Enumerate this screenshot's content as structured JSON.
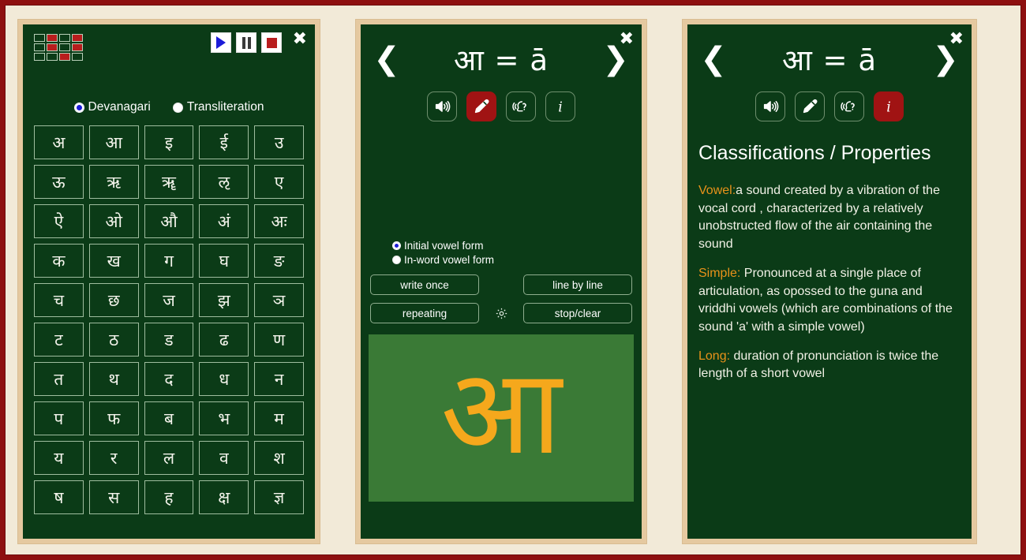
{
  "theme": {
    "outer_border": "#8e1010",
    "page_bg": "#f2ead8",
    "panel_frame": "#e5c9a0",
    "board_bg": "#0b3b17",
    "accent_red": "#a01313",
    "accent_orange": "#e8921a",
    "canvas_bg": "#3a7a36",
    "ink": "#f5a81c",
    "radio_selected": "#1b1bd8"
  },
  "panel1": {
    "close_label": "✖",
    "grid_icon_name": "grid-icon",
    "grid_icon_pattern": [
      [
        0,
        1,
        0,
        1
      ],
      [
        0,
        1,
        0,
        1
      ],
      [
        0,
        0,
        1,
        0
      ]
    ],
    "media": [
      {
        "name": "play-button",
        "label": "play"
      },
      {
        "name": "pause-button",
        "label": "pause"
      },
      {
        "name": "stop-button",
        "label": "stop"
      }
    ],
    "script_modes": [
      {
        "label": "Devanagari",
        "selected": true
      },
      {
        "label": "Transliteration",
        "selected": false
      }
    ],
    "letters": [
      "अ",
      "आ",
      "इ",
      "ई",
      "उ",
      "ऊ",
      "ऋ",
      "ॠ",
      "ऌ",
      "ए",
      "ऐ",
      "ओ",
      "औ",
      "अं",
      "अः",
      "क",
      "ख",
      "ग",
      "घ",
      "ङ",
      "च",
      "छ",
      "ज",
      "झ",
      "ञ",
      "ट",
      "ठ",
      "ड",
      "ढ",
      "ण",
      "त",
      "थ",
      "द",
      "ध",
      "न",
      "प",
      "फ",
      "ब",
      "भ",
      "म",
      "य",
      "र",
      "ल",
      "व",
      "श",
      "ष",
      "स",
      "ह",
      "क्ष",
      "ज्ञ"
    ]
  },
  "panel2": {
    "close_label": "✖",
    "prev_label": "❮",
    "next_label": "❯",
    "title": "आ = ā",
    "icons": [
      {
        "name": "speaker-icon",
        "label": "listen",
        "active": false
      },
      {
        "name": "pencil-icon",
        "label": "write",
        "active": true
      },
      {
        "name": "pronounce-icon",
        "label": "pronounce",
        "active": false
      },
      {
        "name": "info-icon",
        "label": "info",
        "active": false
      }
    ],
    "vowel_forms": [
      {
        "label": "Initial vowel form",
        "selected": true
      },
      {
        "label": "In-word vowel form",
        "selected": false
      }
    ],
    "buttons": {
      "write_once": "write once",
      "line_by_line": "line by line",
      "repeating": "repeating",
      "stop_clear": "stop/clear",
      "settings_name": "gear-icon"
    },
    "canvas_glyph": "आ"
  },
  "panel3": {
    "close_label": "✖",
    "prev_label": "❮",
    "next_label": "❯",
    "title": "आ = ā",
    "icons": [
      {
        "name": "speaker-icon",
        "label": "listen",
        "active": false
      },
      {
        "name": "pencil-icon",
        "label": "write",
        "active": false
      },
      {
        "name": "pronounce-icon",
        "label": "pronounce",
        "active": false
      },
      {
        "name": "info-icon",
        "label": "info",
        "active": true
      }
    ],
    "heading": "Classifications / Properties",
    "entries": [
      {
        "term": "Vowel:",
        "text": "a sound created by a vibration of the vocal cord , characterized by a relatively unobstructed flow of the air containing the sound"
      },
      {
        "term": "Simple:",
        "text": " Pronounced at a single place of articulation, as opossed to the guna and vriddhi vowels (which are combinations of the sound 'a' with a simple vowel)"
      },
      {
        "term": "Long:",
        "text": " duration of pronunciation is twice the length of a short vowel"
      }
    ]
  }
}
